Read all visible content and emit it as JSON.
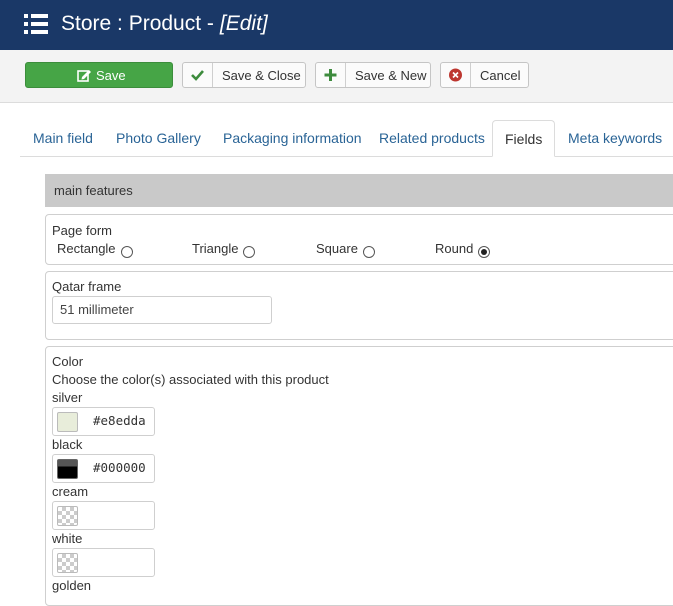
{
  "header": {
    "title": "Store : Product -",
    "edit_label": "[Edit]"
  },
  "toolbar": {
    "save_label": "Save",
    "save_close_label": "Save & Close",
    "save_new_label": "Save & New",
    "cancel_label": "Cancel"
  },
  "tabs": [
    {
      "label": "Main field"
    },
    {
      "label": "Photo Gallery"
    },
    {
      "label": "Packaging information"
    },
    {
      "label": "Related products"
    },
    {
      "label": "Fields",
      "active": true
    },
    {
      "label": "Meta keywords"
    }
  ],
  "section": {
    "title": "main features"
  },
  "page_form": {
    "label": "Page form",
    "options": [
      {
        "label": "Rectangle",
        "checked": false
      },
      {
        "label": "Triangle",
        "checked": false
      },
      {
        "label": "Square",
        "checked": false
      },
      {
        "label": "Round",
        "checked": true
      }
    ]
  },
  "qatar_frame": {
    "label": "Qatar frame",
    "value": "51 millimeter"
  },
  "color": {
    "label": "Color",
    "description": "Choose the color(s) associated with this product",
    "items": [
      {
        "name": "silver",
        "hex": "#e8edda"
      },
      {
        "name": "black",
        "hex": "#000000"
      },
      {
        "name": "cream",
        "hex": ""
      },
      {
        "name": "white",
        "hex": ""
      },
      {
        "name": "golden",
        "hex": ""
      }
    ]
  },
  "colors": {
    "header_bg": "#1a3867",
    "save_green": "#46a546",
    "link_blue": "#2a6496",
    "section_gray": "#c9c9c9"
  }
}
